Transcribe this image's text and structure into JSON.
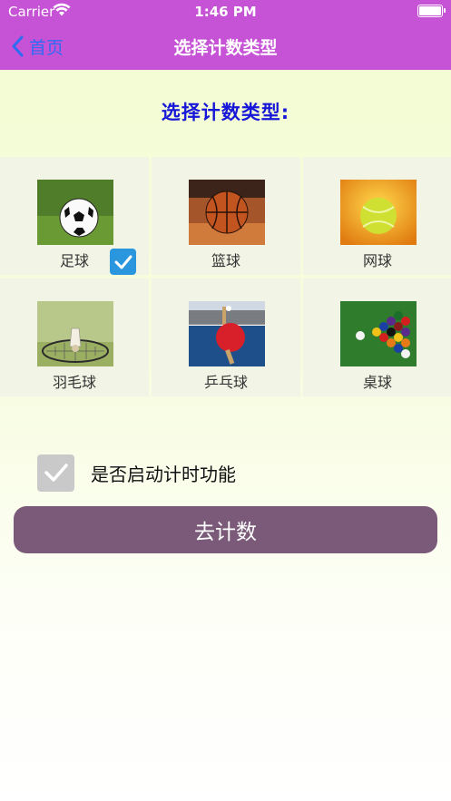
{
  "status_bar": {
    "carrier": "Carrier",
    "time": "1:46 PM"
  },
  "nav": {
    "back_label": "首页",
    "title": "选择计数类型"
  },
  "prompt": "选择计数类型:",
  "sports": [
    {
      "label": "足球",
      "icon": "soccer-ball",
      "selected": true
    },
    {
      "label": "篮球",
      "icon": "basketball",
      "selected": false
    },
    {
      "label": "网球",
      "icon": "tennis-ball",
      "selected": false
    },
    {
      "label": "羽毛球",
      "icon": "badminton",
      "selected": false
    },
    {
      "label": "乒乓球",
      "icon": "table-tennis",
      "selected": false
    },
    {
      "label": "桌球",
      "icon": "billiards",
      "selected": false
    }
  ],
  "timer": {
    "label": "是否启动计时功能",
    "checked": true
  },
  "go_button": "去计数",
  "colors": {
    "header": "#c653d6",
    "back_link": "#2c6cf2",
    "prompt_text": "#1717d8",
    "checkbox_selected": "#2a96de",
    "timer_checkbox": "#c9c9c9",
    "go_button": "#7a5a78"
  }
}
